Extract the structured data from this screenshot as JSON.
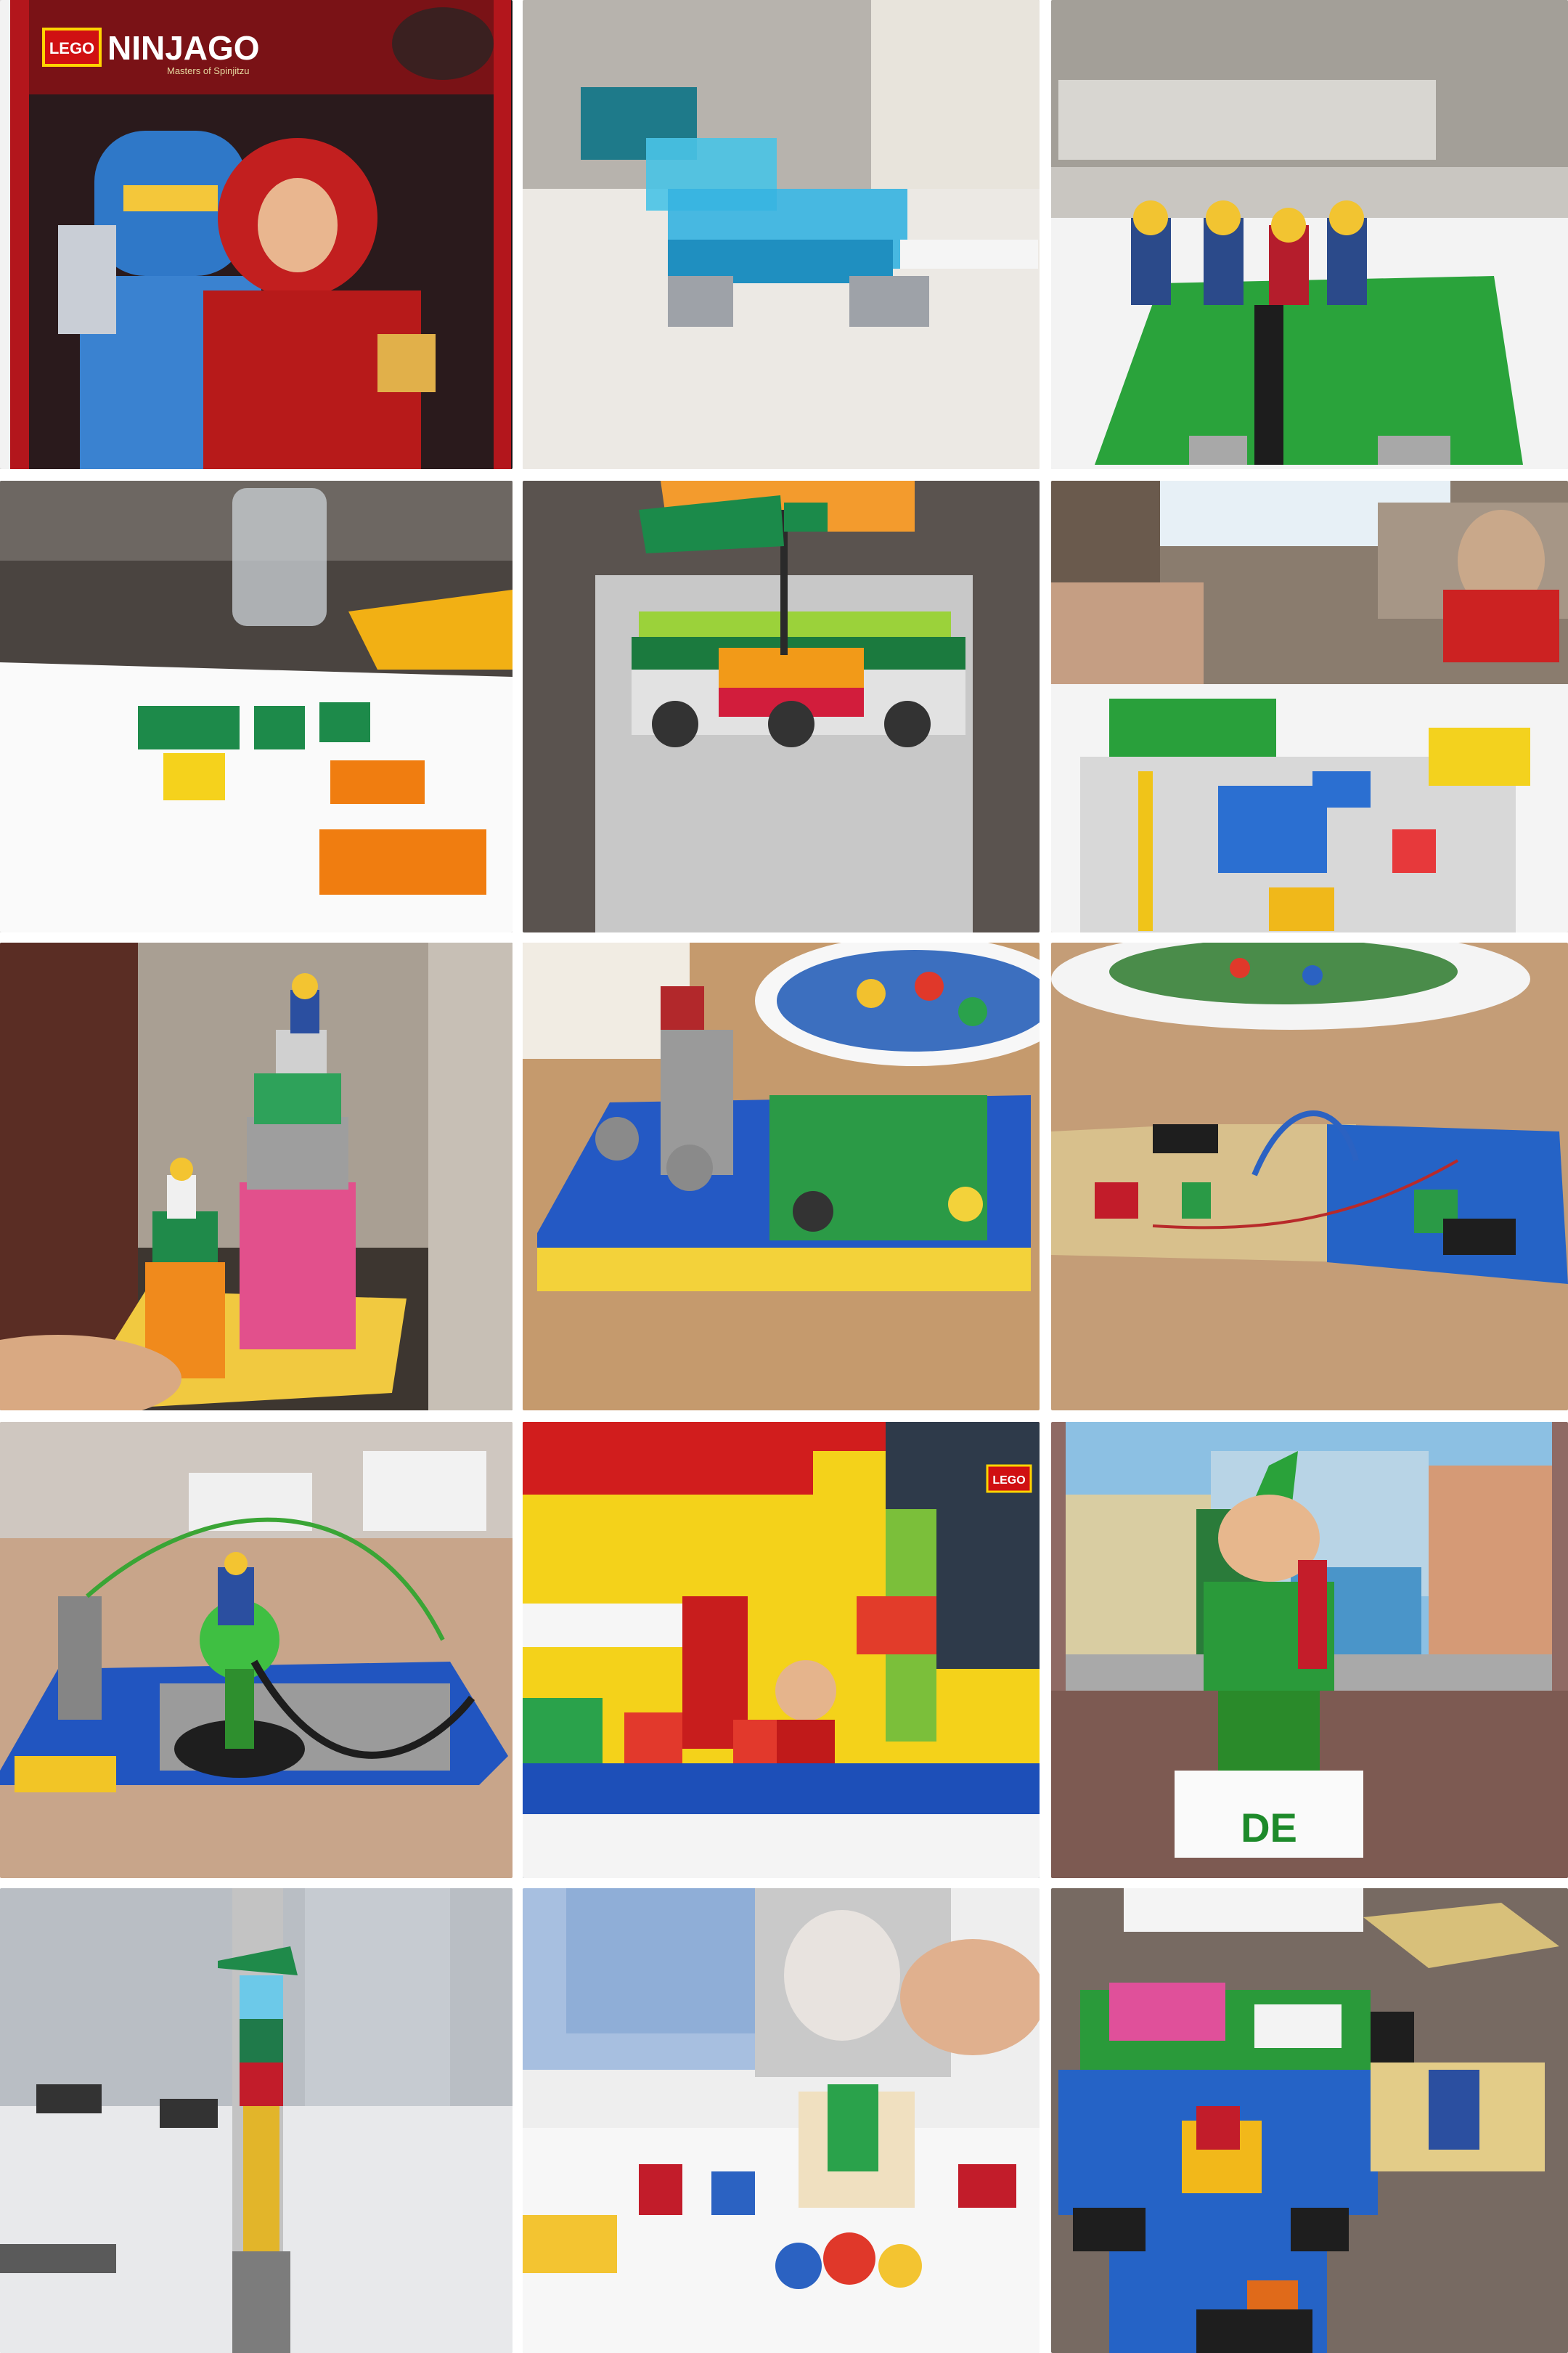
{
  "gallery": {
    "tiles": [
      {
        "id": "ninjago-poster",
        "logo": "LEGO",
        "title": "NINJAGO",
        "subtitle": "Masters of Spinjitzu"
      },
      {
        "id": "transparent-blue-build"
      },
      {
        "id": "minifigs-green-baseplate"
      },
      {
        "id": "colored-bricks-on-paper"
      },
      {
        "id": "flag-bridge-build"
      },
      {
        "id": "team-building-table"
      },
      {
        "id": "tower-held-in-hand"
      },
      {
        "id": "machine-build-with-bricks-plate"
      },
      {
        "id": "wired-build-beige-blue"
      },
      {
        "id": "wired-tower-build"
      },
      {
        "id": "kids-party-room",
        "logo": "LEGO"
      },
      {
        "id": "elf-minifig-standee",
        "sign": "DE"
      },
      {
        "id": "tall-tower-build"
      },
      {
        "id": "group-city-build"
      },
      {
        "id": "connected-baseplates-build"
      }
    ]
  }
}
